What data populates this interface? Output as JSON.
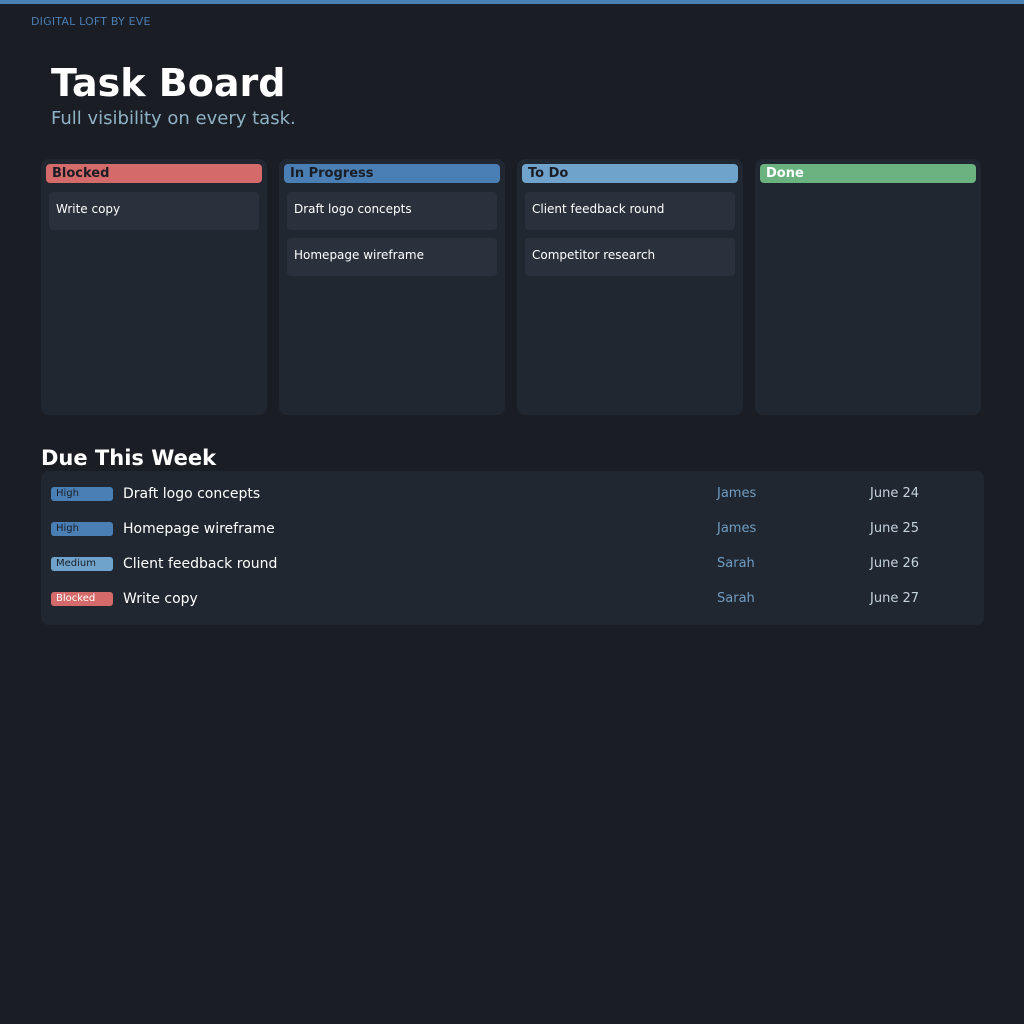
{
  "app": {
    "brand": "DIGITAL LOFT BY EVE",
    "title": "Task Board",
    "subtitle": "Full visibility on every task."
  },
  "colors": {
    "accent": "#4a7fb5",
    "blocked": "#d46a6a",
    "in_progress": "#4a7fb5",
    "todo": "#6fa3cb",
    "done": "#6ab27f"
  },
  "board": {
    "columns": [
      {
        "label": "Blocked",
        "cards": [
          "Write copy"
        ]
      },
      {
        "label": "In Progress",
        "cards": [
          "Draft logo concepts",
          "Homepage wireframe"
        ]
      },
      {
        "label": "To Do",
        "cards": [
          "Client feedback round",
          "Competitor research"
        ]
      },
      {
        "label": "Done",
        "cards": []
      }
    ]
  },
  "due": {
    "title": "Due This Week",
    "rows": [
      {
        "priority": "High",
        "task": "Draft logo concepts",
        "assignee": "James",
        "date": "June 24"
      },
      {
        "priority": "High",
        "task": "Homepage wireframe",
        "assignee": "James",
        "date": "June 25"
      },
      {
        "priority": "Medium",
        "task": "Client feedback round",
        "assignee": "Sarah",
        "date": "June 26"
      },
      {
        "priority": "Blocked",
        "task": "Write copy",
        "assignee": "Sarah",
        "date": "June 27"
      }
    ]
  }
}
